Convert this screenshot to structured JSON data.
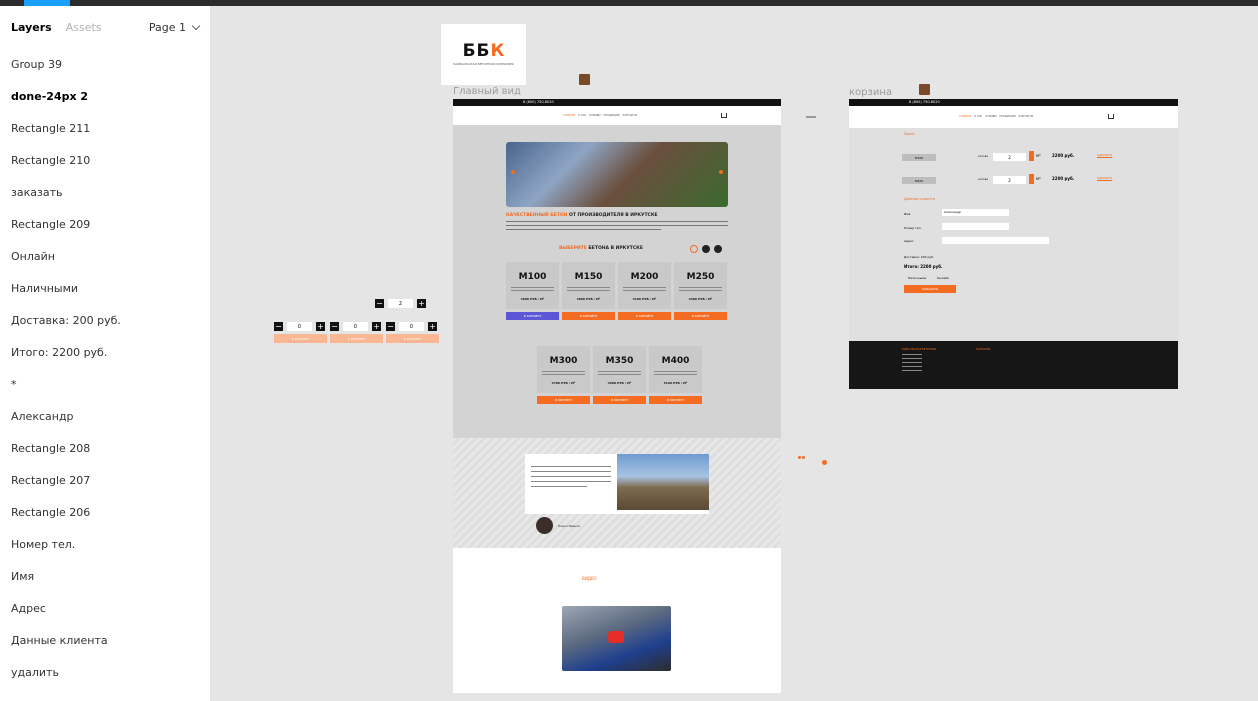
{
  "sidebar": {
    "tabs": [
      "Layers",
      "Assets"
    ],
    "page": "Page 1",
    "layers": [
      "Group 39",
      "done-24px 2",
      "Rectangle 211",
      "Rectangle 210",
      "заказать",
      "Rectangle 209",
      "Онлайн",
      "Наличными",
      "Доставка: 200 руб.",
      "Итого: 2200 руб.",
      "*",
      "Александр",
      "Rectangle 208",
      "Rectangle 207",
      "Rectangle 206",
      "Номер тел.",
      "Имя",
      "Адрес",
      "Данные клиента",
      "удалить"
    ]
  },
  "canvas": {
    "frame_main_label": "Главный вид",
    "frame_cart_label": "корзина",
    "logo_letters": [
      "Б",
      "Б",
      "К"
    ],
    "logo_sub": "БАЙКАЛЬСКАЯ БЕТОННАЯ КОМПАНИЯ",
    "stepper_value": "2",
    "stepper_zero": "0",
    "peach_btn": "В КОРЗИНУ",
    "main": {
      "phone": "8 (800) 750-8020",
      "heading_a": "КАЧЕСТВЕННЫЙ БЕТОН",
      "heading_b": " ОТ ПРОИЗВОДИТЕЛЯ В ИРКУТСКЕ",
      "section_a": "ВЫБЕРИТЕ",
      "section_b": " БЕТОНА В ИРКУТСКЕ",
      "cards_row1": [
        {
          "m": "М100",
          "p": "3600 РУБ / М³"
        },
        {
          "m": "М150",
          "p": "3800 РУБ / М³"
        },
        {
          "m": "М200",
          "p": "4100 РУБ / М³"
        },
        {
          "m": "М250",
          "p": "4300 РУБ / М³"
        }
      ],
      "cards_row2": [
        {
          "m": "М300",
          "p": "4700 РУБ / М³"
        },
        {
          "m": "М350",
          "p": "4900 РУБ / М³"
        },
        {
          "m": "М400",
          "p": "5100 РУБ / М³"
        }
      ],
      "card_btn": "В КОРЗИНУ",
      "review_name": "Павел Иванов",
      "video_title": "ВИДЕО"
    },
    "cart": {
      "phone": "8 (800) 750-8020",
      "title": "Заказ",
      "rows": [
        {
          "label": "М100",
          "qty": "2",
          "price": "2200 руб.",
          "del": "удалить"
        },
        {
          "label": "М200",
          "qty": "2",
          "price": "2200 руб.",
          "del": "удалить"
        }
      ],
      "client_title": "Данные клиента",
      "name_label": "Имя",
      "name_val": "Александр",
      "phone_label": "Номер тел.",
      "addr_label": "Адрес",
      "delivery": "Доставка: 200 руб.",
      "total": "Итого: 2200 руб.",
      "pay_a": "Наличными",
      "pay_b": "Онлайн",
      "order_btn": "ЗАКАЗАТЬ",
      "footer_a": "БАЙКАЛЬСКАЯ БЕТОННАЯ",
      "footer_b": "КОНТАКТЫ"
    }
  },
  "colors": {
    "accent": "#f36c21",
    "selection": "#18a0fb",
    "purple_btn": "#5b57d6"
  }
}
